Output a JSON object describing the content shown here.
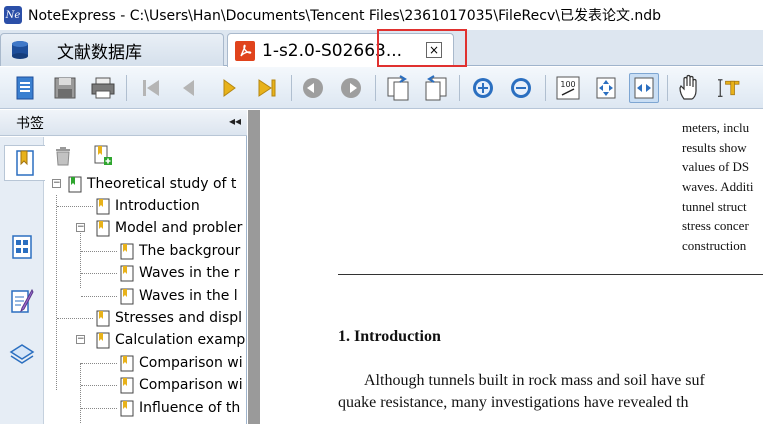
{
  "window": {
    "app_icon_label": "Ne",
    "title": "NoteExpress - C:\\Users\\Han\\Documents\\Tencent Files\\2361017035\\FileRecv\\已发表论文.ndb"
  },
  "tabs": [
    {
      "label": "文献数据库",
      "icon": "database-icon"
    },
    {
      "label": "1-s2.0-S02663...",
      "icon": "pdf-icon",
      "close": "×"
    }
  ],
  "toolbar": {
    "icons": [
      "document-icon",
      "save-icon",
      "print-icon",
      "first-page-icon",
      "previous-page-icon",
      "next-page-icon",
      "last-page-icon",
      "back-icon",
      "forward-icon",
      "copy-icon",
      "paste-icon",
      "zoom-in-icon",
      "zoom-out-icon",
      "actual-size-icon",
      "fit-page-icon",
      "fit-width-icon",
      "hand-tool-icon",
      "text-select-icon"
    ],
    "actual_size_label": "100"
  },
  "bookmarks_panel": {
    "title": "书签",
    "collapse_glyph": "◂◂",
    "tree": [
      {
        "label": "Theoretical study of t",
        "level": 0,
        "expander": "−"
      },
      {
        "label": "Introduction",
        "level": 1,
        "expander": ""
      },
      {
        "label": "Model and probler",
        "level": 1,
        "expander": "−"
      },
      {
        "label": "The backgrour",
        "level": 2,
        "expander": ""
      },
      {
        "label": "Waves in the r",
        "level": 2,
        "expander": ""
      },
      {
        "label": "Waves in the l",
        "level": 2,
        "expander": ""
      },
      {
        "label": "Stresses and displ",
        "level": 1,
        "expander": ""
      },
      {
        "label": "Calculation examp",
        "level": 1,
        "expander": "−"
      },
      {
        "label": "Comparison wi",
        "level": 2,
        "expander": ""
      },
      {
        "label": "Comparison wi",
        "level": 2,
        "expander": ""
      },
      {
        "label": "Influence of th",
        "level": 2,
        "expander": ""
      }
    ]
  },
  "document": {
    "right_column_lines": [
      "meters, inclu",
      "results show",
      "values of DS",
      "waves. Additi",
      "tunnel struct",
      "stress concer",
      "construction"
    ],
    "section_heading": "1.  Introduction",
    "paragraph_lines": [
      "Although tunnels built in rock mass and soil have suf",
      "quake resistance, many investigations have revealed th"
    ]
  },
  "colors": {
    "accent_highlight": "#e0312f",
    "toolbar_blue": "#2b6fc0",
    "play_gold": "#e8b21a"
  }
}
